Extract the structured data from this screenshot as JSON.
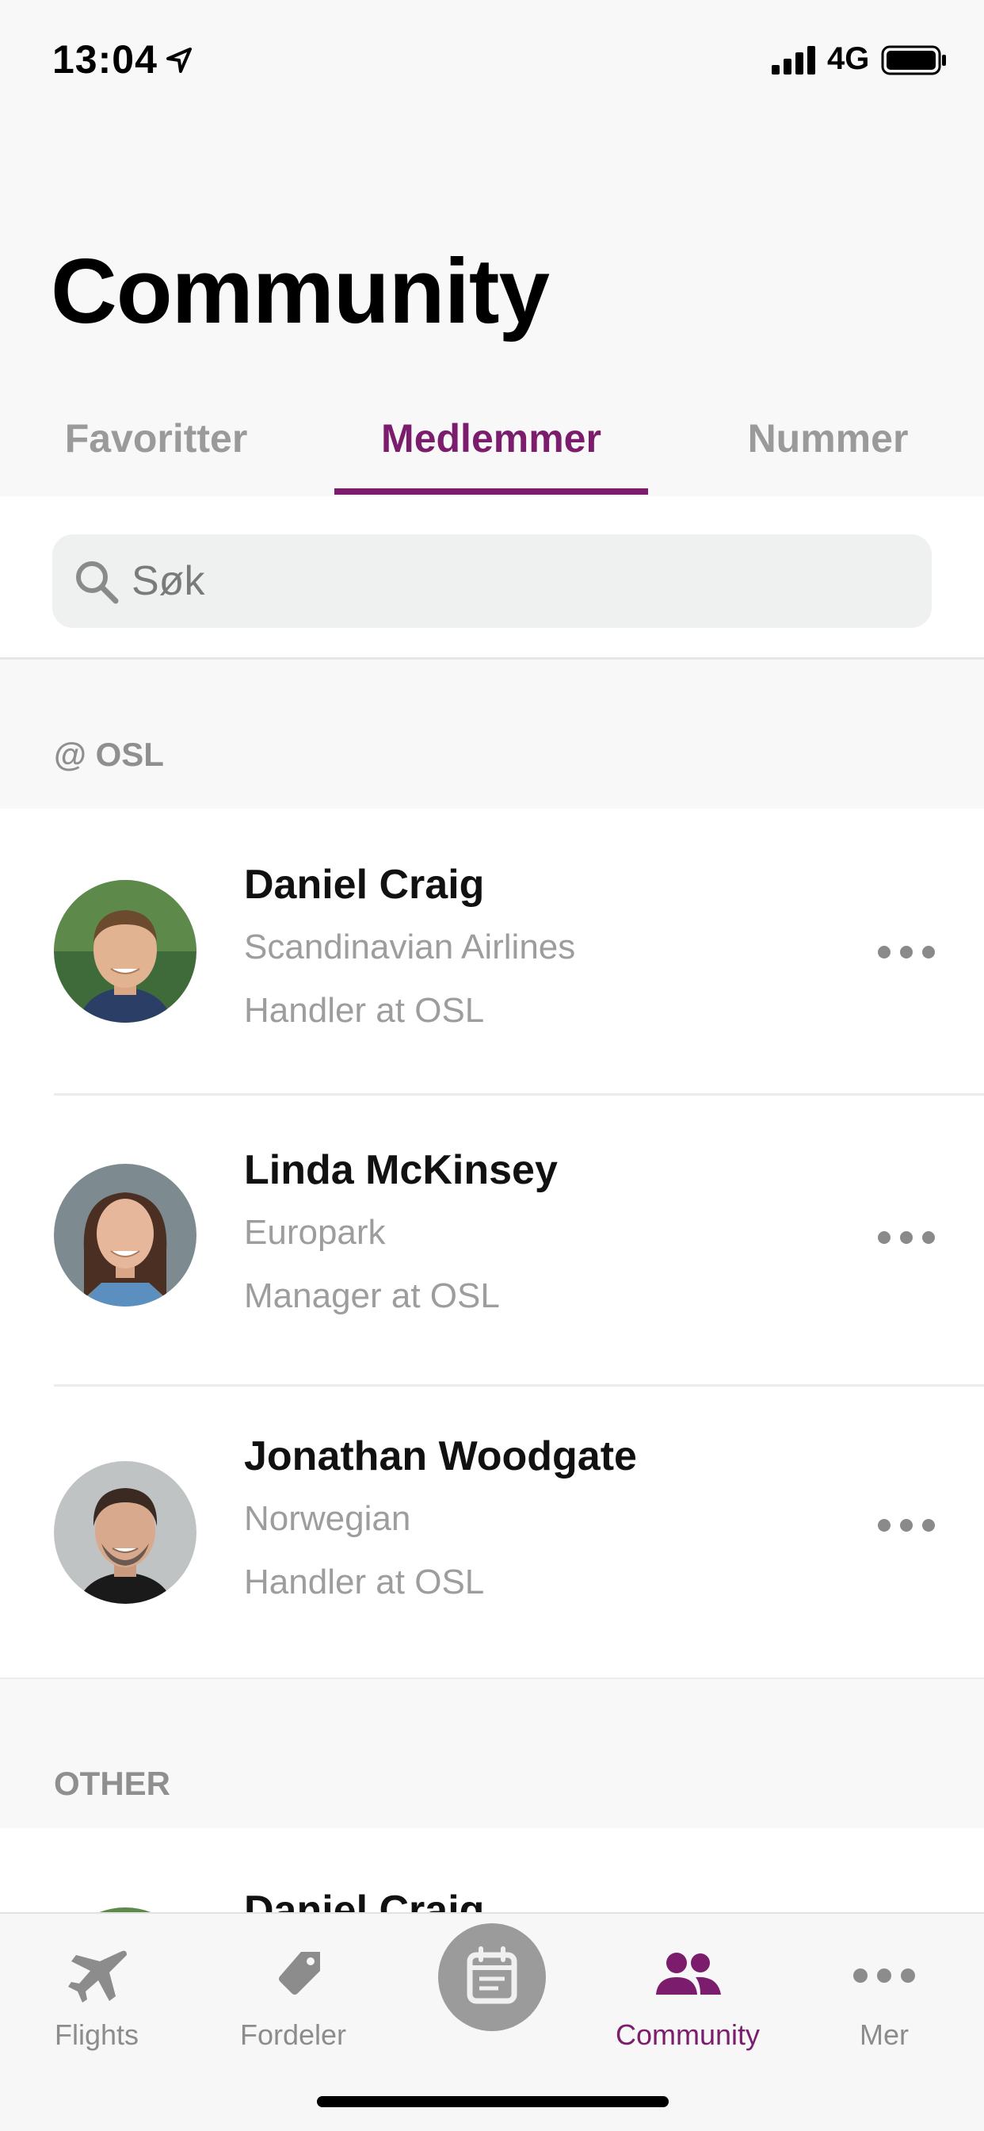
{
  "status_bar": {
    "time": "13:04",
    "network": "4G"
  },
  "title": "Community",
  "tabs": [
    {
      "label": "Favoritter",
      "active": false
    },
    {
      "label": "Medlemmer",
      "active": true
    },
    {
      "label": "Nummer",
      "active": false
    }
  ],
  "search": {
    "placeholder": "Søk"
  },
  "sections": [
    {
      "label": "@ OSL",
      "members": [
        {
          "name": "Daniel Craig",
          "company": "Scandinavian Airlines",
          "role": "Handler at OSL"
        },
        {
          "name": "Linda McKinsey",
          "company": "Europark",
          "role": "Manager at OSL"
        },
        {
          "name": "Jonathan Woodgate",
          "company": "Norwegian",
          "role": "Handler at OSL"
        }
      ]
    },
    {
      "label": "OTHER",
      "members": [
        {
          "name": "Daniel Craig"
        }
      ]
    }
  ],
  "tab_bar": [
    {
      "label": "Flights",
      "icon": "airplane-icon"
    },
    {
      "label": "Fordeler",
      "icon": "tag-icon"
    },
    {
      "label": "",
      "icon": "calendar-icon"
    },
    {
      "label": "Community",
      "icon": "people-icon",
      "active": true
    },
    {
      "label": "Mer",
      "icon": "ellipsis-icon"
    }
  ],
  "colors": {
    "accent": "#7b1c6d",
    "inactive": "#9a9a9a",
    "background": "#f8f8f8"
  }
}
